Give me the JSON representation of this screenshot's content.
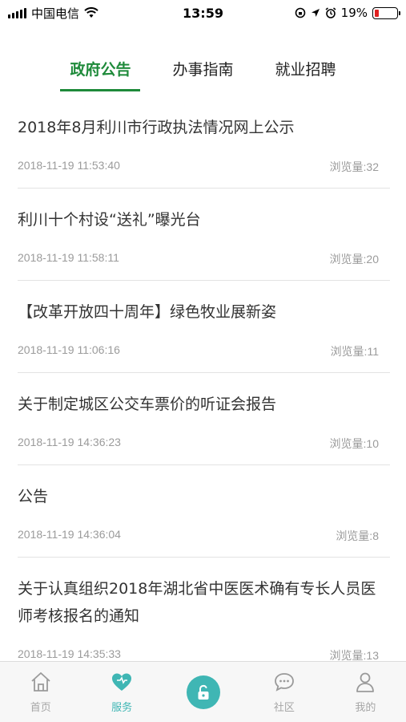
{
  "status_bar": {
    "carrier": "中国电信",
    "time": "13:59",
    "battery_percent": "19%",
    "battery_level": 0.19,
    "icons": [
      "signal-icon",
      "wifi-icon",
      "lock-rotation-icon",
      "location-icon",
      "alarm-icon",
      "battery-icon"
    ]
  },
  "tabs": [
    {
      "label": "政府公告",
      "active": true
    },
    {
      "label": "办事指南",
      "active": false
    },
    {
      "label": "就业招聘",
      "active": false
    }
  ],
  "news": [
    {
      "title": "2018年8月利川市行政执法情况网上公示",
      "date": "2018-11-19 11:53:40",
      "views": "浏览量:32"
    },
    {
      "title": "利川十个村设“送礼”曝光台",
      "date": "2018-11-19 11:58:11",
      "views": "浏览量:20"
    },
    {
      "title": "【改革开放四十周年】绿色牧业展新姿",
      "date": "2018-11-19 11:06:16",
      "views": "浏览量:11"
    },
    {
      "title": "关于制定城区公交车票价的听证会报告",
      "date": "2018-11-19 14:36:23",
      "views": "浏览量:10"
    },
    {
      "title": "公告",
      "date": "2018-11-19 14:36:04",
      "views": "浏览量:8"
    },
    {
      "title": "关于认真组织2018年湖北省中医医术确有专长人员医师考核报名的通知",
      "date": "2018-11-19 14:35:33",
      "views": "浏览量:13"
    }
  ],
  "bottom_nav": [
    {
      "label": "首页",
      "icon": "home-icon"
    },
    {
      "label": "服务",
      "icon": "heart-icon",
      "active": true
    },
    {
      "label": "",
      "icon": "unlock-icon"
    },
    {
      "label": "社区",
      "icon": "chat-icon"
    },
    {
      "label": "我的",
      "icon": "user-icon"
    }
  ],
  "colors": {
    "accent_green": "#1e8a3a",
    "accent_teal": "#3fb6b4",
    "battery_red": "#e02020",
    "meta_gray": "#9b9b9b"
  }
}
